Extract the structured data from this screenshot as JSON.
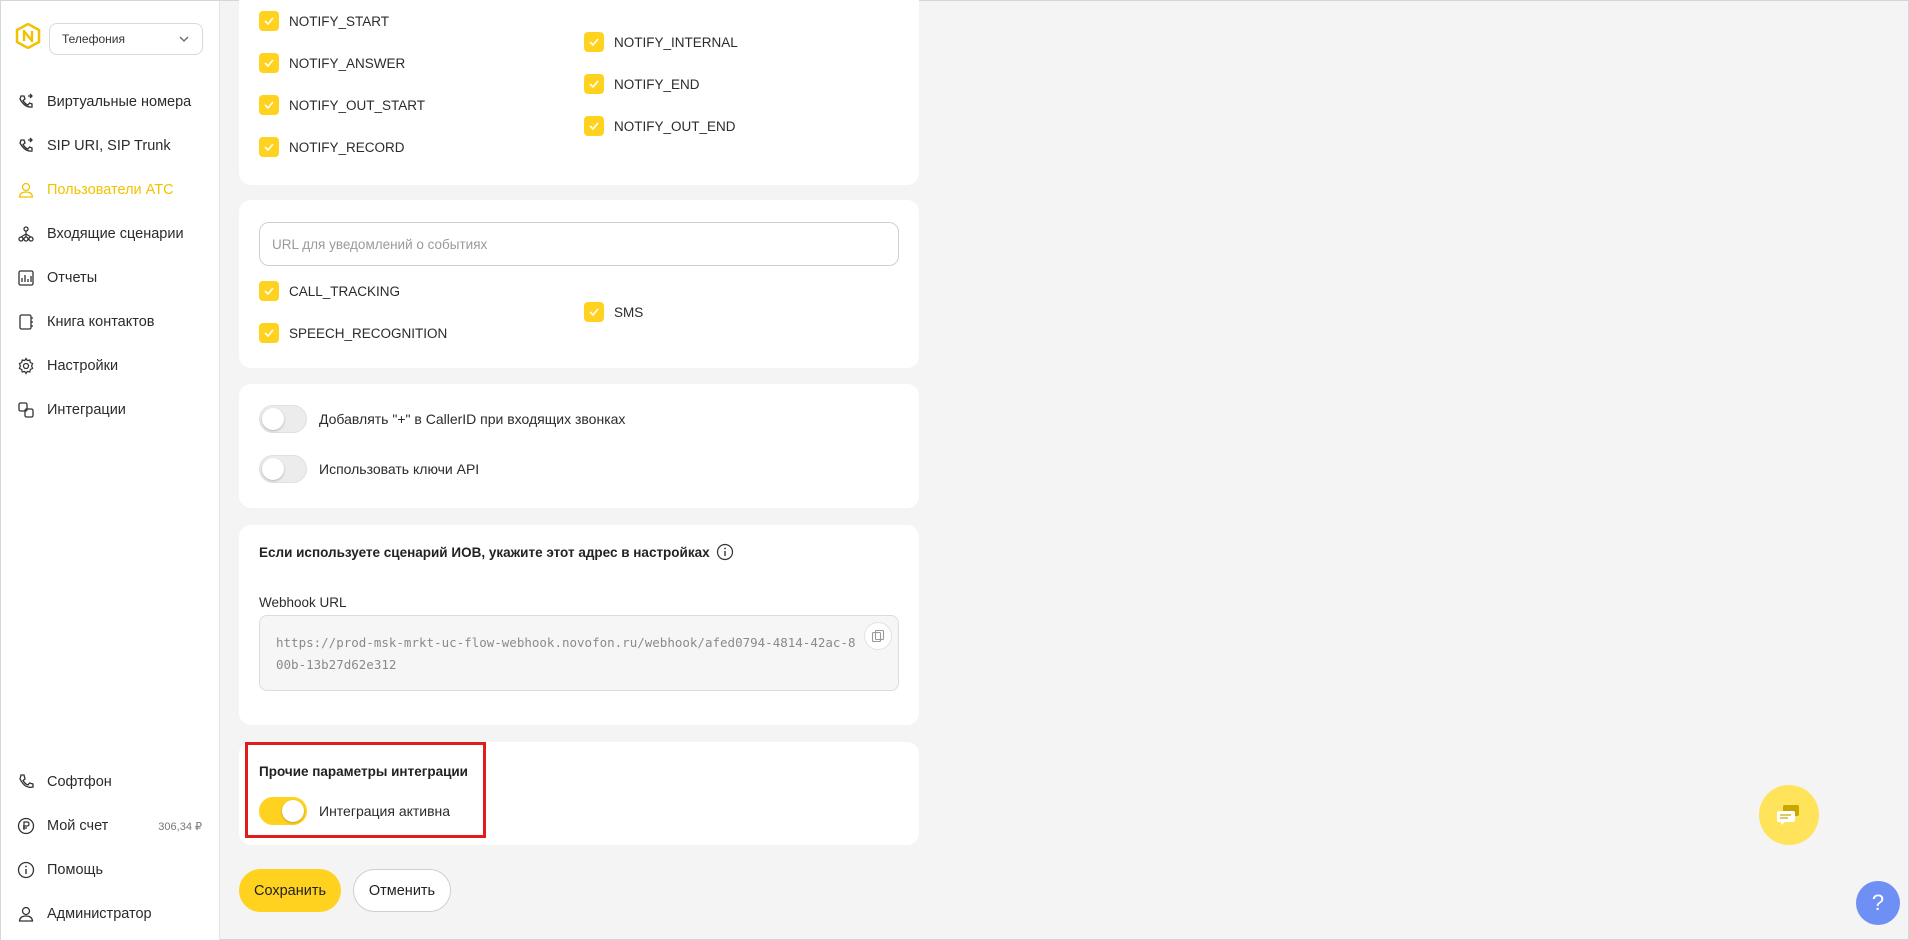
{
  "sidebar": {
    "product_select": "Телефония",
    "nav_top": [
      {
        "label": "Виртуальные номера",
        "icon": "phone-forward-icon"
      },
      {
        "label": "SIP URI, SIP Trunk",
        "icon": "phone-forward-icon"
      },
      {
        "label": "Пользователи АТС",
        "icon": "user-icon",
        "active": true
      },
      {
        "label": "Входящие сценарии",
        "icon": "flow-icon"
      },
      {
        "label": "Отчеты",
        "icon": "report-icon"
      },
      {
        "label": "Книга контактов",
        "icon": "contacts-book-icon"
      },
      {
        "label": "Настройки",
        "icon": "gear-icon"
      },
      {
        "label": "Интеграции",
        "icon": "integration-icon"
      }
    ],
    "nav_bottom": [
      {
        "label": "Софтфон",
        "icon": "phone-icon"
      },
      {
        "label": "Мой счет",
        "icon": "ruble-icon",
        "amount": "306,34 ₽"
      },
      {
        "label": "Помощь",
        "icon": "info-icon"
      },
      {
        "label": "Администратор",
        "icon": "user-icon"
      }
    ]
  },
  "notify_events": {
    "left": [
      "NOTIFY_START",
      "NOTIFY_ANSWER",
      "NOTIFY_OUT_START",
      "NOTIFY_RECORD"
    ],
    "right": [
      "NOTIFY_INTERNAL",
      "NOTIFY_END",
      "NOTIFY_OUT_END"
    ]
  },
  "event_url": {
    "placeholder": "URL для уведомлений о событиях",
    "left": [
      "CALL_TRACKING",
      "SPEECH_RECOGNITION"
    ],
    "right": [
      "SMS"
    ]
  },
  "toggles": {
    "plus_callerid": "Добавлять \"+\" в CallerID при входящих звонках",
    "api_keys": "Использовать ключи API"
  },
  "ivr": {
    "title": "Если используете сценарий ИОВ, укажите этот адрес в настройках",
    "webhook_label": "Webhook URL",
    "webhook_url": "https://prod-msk-mrkt-uc-flow-webhook.novofon.ru/webhook/afed0794-4814-42ac-800b-13b27d62e312"
  },
  "other": {
    "title": "Прочие параметры интеграции",
    "active_label": "Интеграция активна"
  },
  "actions": {
    "save": "Сохранить",
    "cancel": "Отменить"
  },
  "help_label": "?",
  "colors": {
    "accent": "#ffd21f",
    "highlight": "#e01d1d",
    "help": "#6e8ff3"
  }
}
